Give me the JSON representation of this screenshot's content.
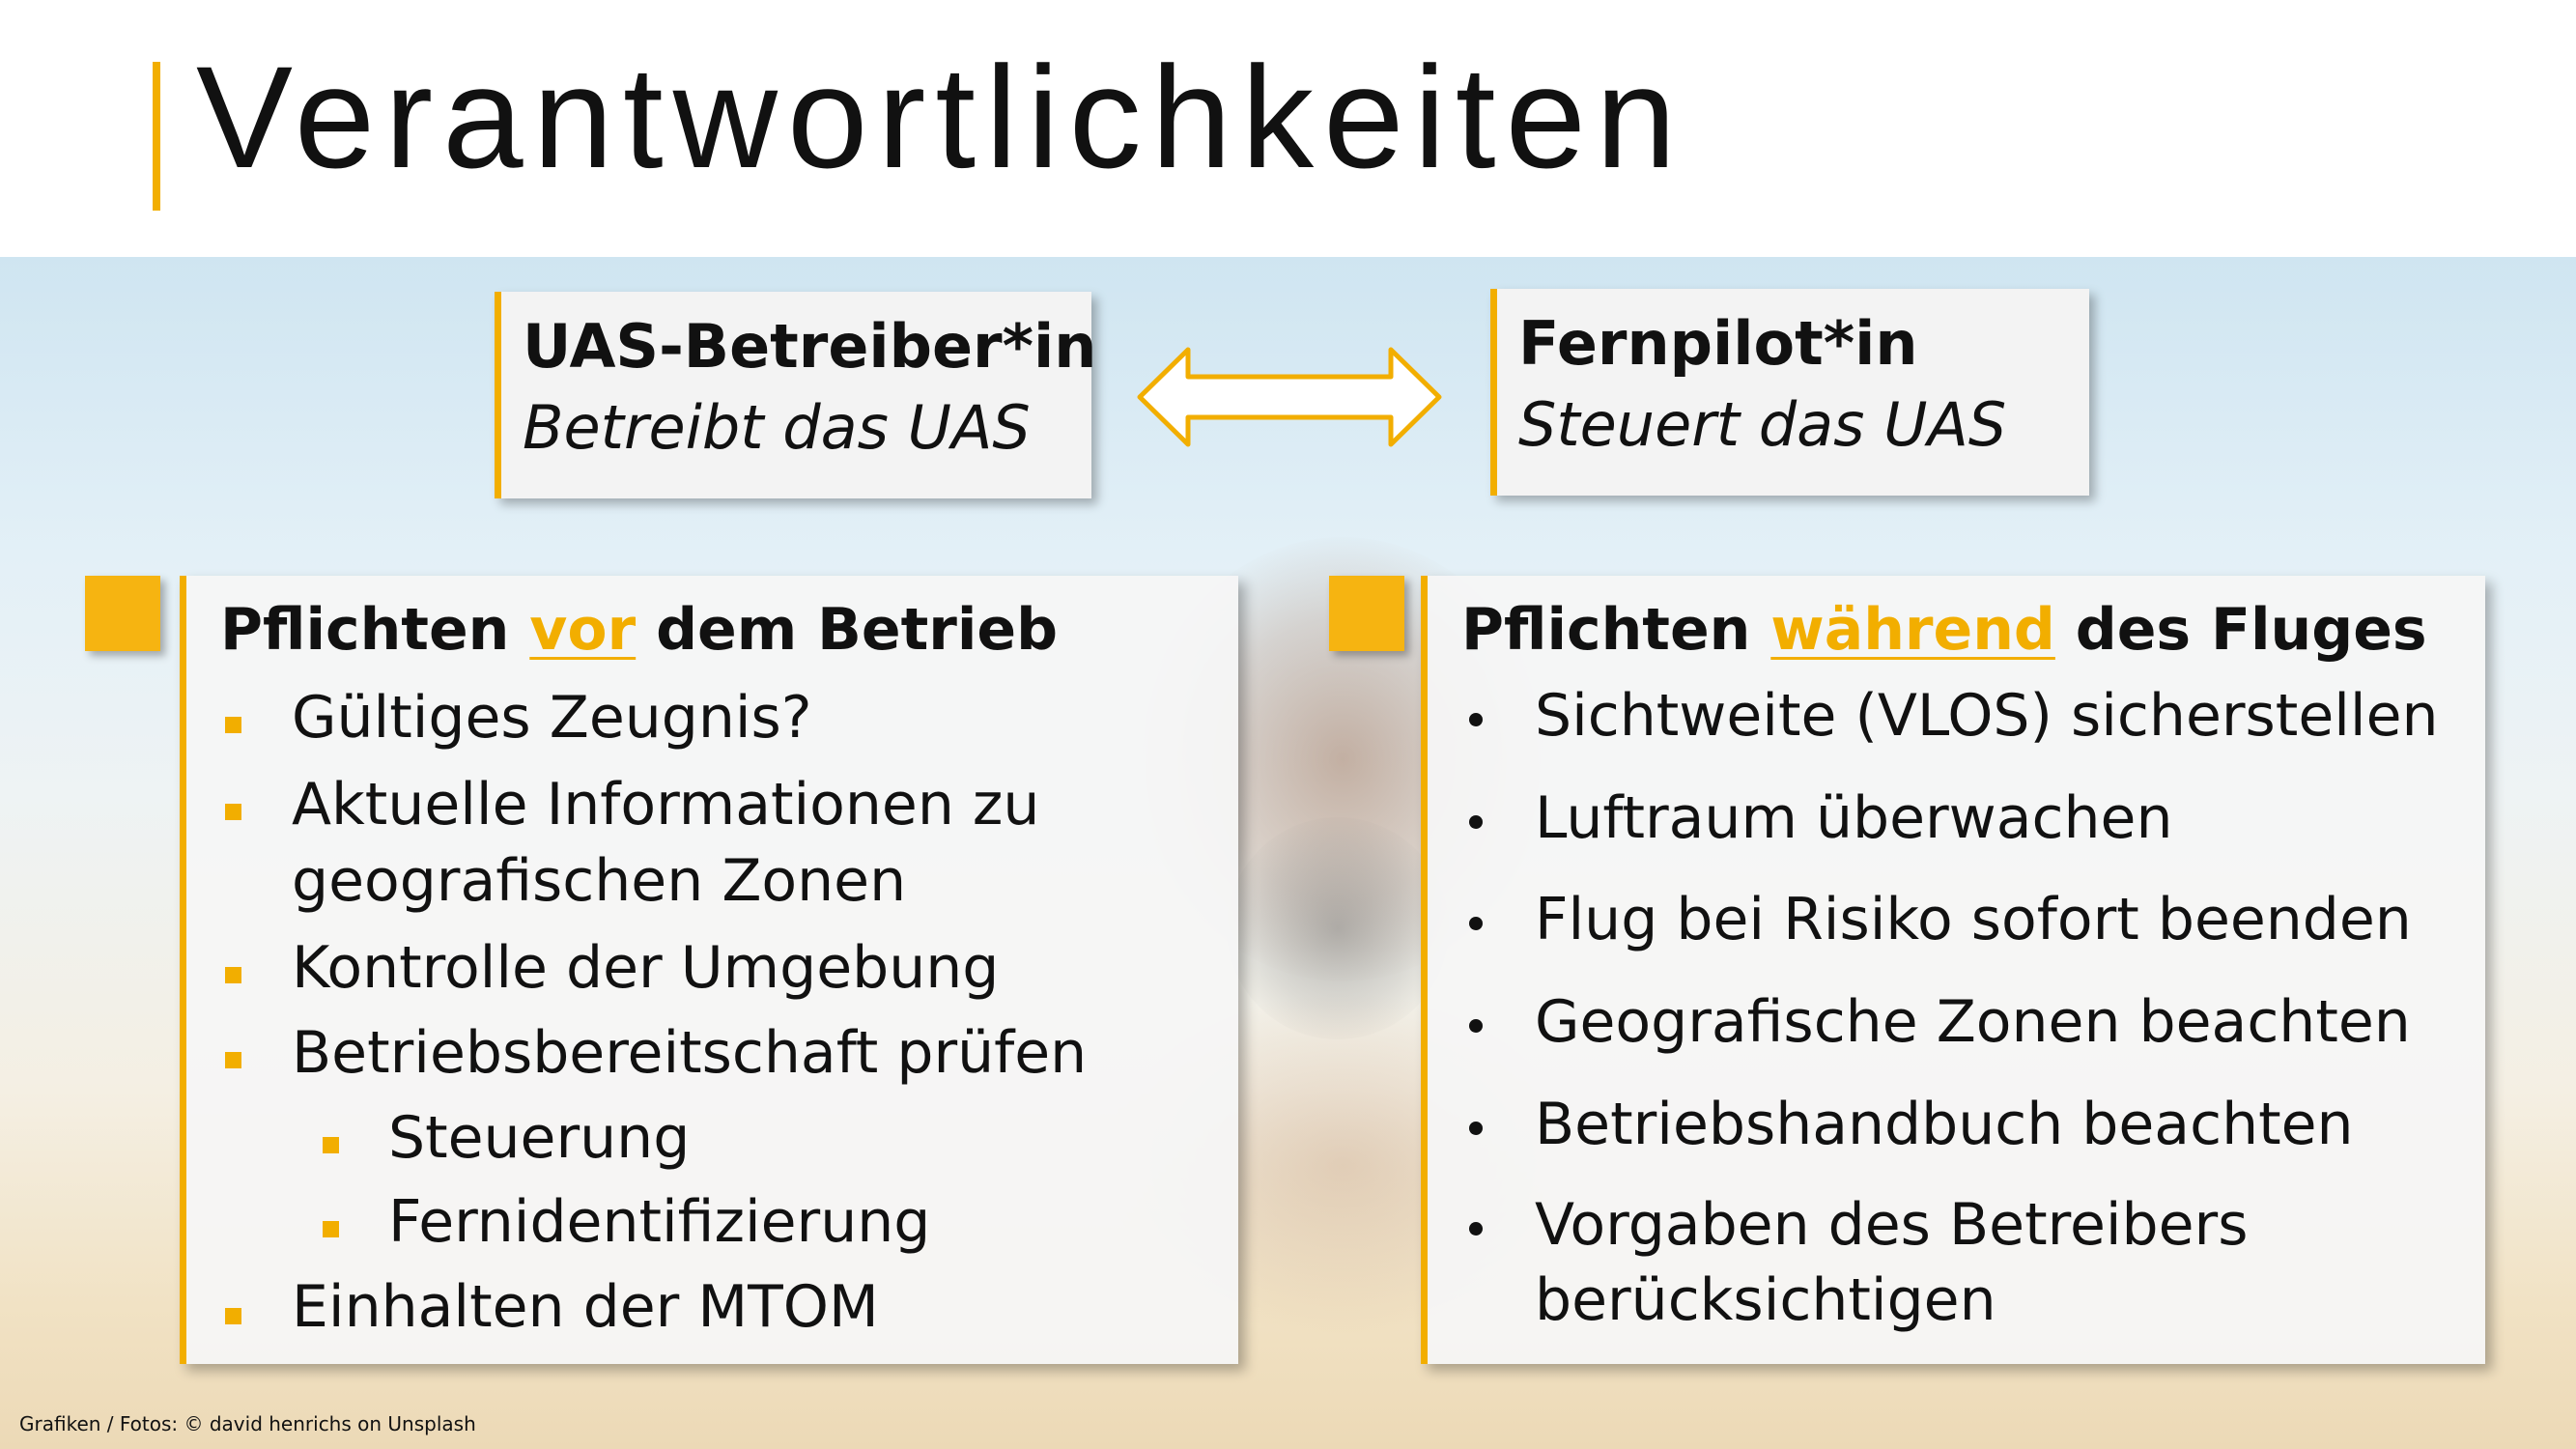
{
  "slide": {
    "title": "Verantwortlichkeiten",
    "accent_color": "#F2AE00",
    "credit": "Grafiken / Fotos: © david henrichs on Unsplash"
  },
  "roles": {
    "left": {
      "title": "UAS-Betreiber*in",
      "subtitle": "Betreibt das UAS"
    },
    "right": {
      "title": "Fernpilot*in",
      "subtitle": "Steuert das UAS"
    },
    "connector_icon": "double-arrow-icon"
  },
  "panels": {
    "left": {
      "title_before": "Pflichten ",
      "title_highlight": "vor",
      "title_after": " dem Betrieb",
      "bullet_icon": "square-bullet-icon",
      "items": [
        {
          "line1": "Gültiges Zeugnis?"
        },
        {
          "line1": "Aktuelle Informationen zu",
          "line2": "geografischen Zonen"
        },
        {
          "line1": "Kontrolle der Umgebung"
        },
        {
          "line1": "Betriebsbereitschaft prüfen"
        },
        {
          "line1": "Steuerung"
        },
        {
          "line1": "Fernidentifizierung"
        },
        {
          "line1": "Einhalten der MTOM"
        }
      ]
    },
    "right": {
      "title_before": "Pflichten ",
      "title_highlight": "während",
      "title_after": " des Fluges",
      "bullet_icon": "dot-bullet-icon",
      "items": [
        {
          "line1": "Sichtweite (VLOS) sicherstellen"
        },
        {
          "line1": "Luftraum überwachen"
        },
        {
          "line1": "Flug bei Risiko sofort beenden"
        },
        {
          "line1": "Geografische Zonen beachten"
        },
        {
          "line1": "Betriebshandbuch beachten"
        },
        {
          "line1": "Vorgaben des Betreibers",
          "line2": "berücksichtigen"
        }
      ]
    }
  }
}
